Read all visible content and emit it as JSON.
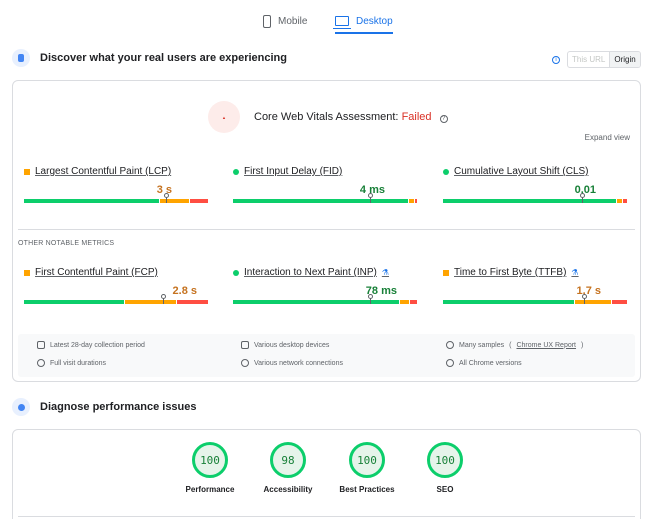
{
  "tabs": [
    {
      "label": "Mobile",
      "icon": "phone-icon",
      "active": false
    },
    {
      "label": "Desktop",
      "icon": "monitor-icon",
      "active": true
    }
  ],
  "field_section": {
    "title": "Discover what your real users are experiencing",
    "url_toggle": {
      "this_url": "This URL",
      "origin": "Origin",
      "selected": "Origin"
    }
  },
  "assessment": {
    "label": "Core Web Vitals Assessment:",
    "status": "Failed",
    "status_color": "#d93025",
    "expand_label": "Expand view"
  },
  "core_metrics": [
    {
      "name": "Largest Contentful Paint (LCP)",
      "value": "3 s",
      "rating": "needs-improvement",
      "dist": [
        0.74,
        0.16,
        0.1
      ],
      "marker": 0.77
    },
    {
      "name": "First Input Delay (FID)",
      "value": "4 ms",
      "rating": "good",
      "dist": [
        0.96,
        0.03,
        0.01
      ],
      "marker": 0.74
    },
    {
      "name": "Cumulative Layout Shift (CLS)",
      "value": "0.01",
      "rating": "good",
      "dist": [
        0.95,
        0.03,
        0.02
      ],
      "marker": 0.75
    }
  ],
  "other_heading": "OTHER NOTABLE METRICS",
  "other_metrics": [
    {
      "name": "First Contentful Paint (FCP)",
      "value": "2.8 s",
      "rating": "needs-improvement",
      "experimental": false,
      "dist": [
        0.55,
        0.28,
        0.17
      ],
      "marker": 0.75
    },
    {
      "name": "Interaction to Next Paint (INP)",
      "value": "78 ms",
      "rating": "good",
      "experimental": true,
      "dist": [
        0.91,
        0.05,
        0.04
      ],
      "marker": 0.74
    },
    {
      "name": "Time to First Byte (TTFB)",
      "value": "1.7 s",
      "rating": "needs-improvement",
      "experimental": true,
      "dist": [
        0.72,
        0.2,
        0.08
      ],
      "marker": 0.76
    }
  ],
  "info": {
    "period": "Latest 28-day collection period",
    "devices": "Various desktop devices",
    "samples": "Many samples",
    "samples_link": "Chrome UX Report",
    "durations": "Full visit durations",
    "connections": "Various network connections",
    "versions": "All Chrome versions"
  },
  "lab_section": {
    "title": "Diagnose performance issues"
  },
  "scores": [
    {
      "label": "Performance",
      "score": "100"
    },
    {
      "label": "Accessibility",
      "score": "98"
    },
    {
      "label": "Best Practices",
      "score": "100"
    },
    {
      "label": "SEO",
      "score": "100"
    }
  ],
  "colors": {
    "good": "#0cce6b",
    "average": "#ffa400",
    "poor": "#ff4e42",
    "accent": "#1a73e8"
  }
}
